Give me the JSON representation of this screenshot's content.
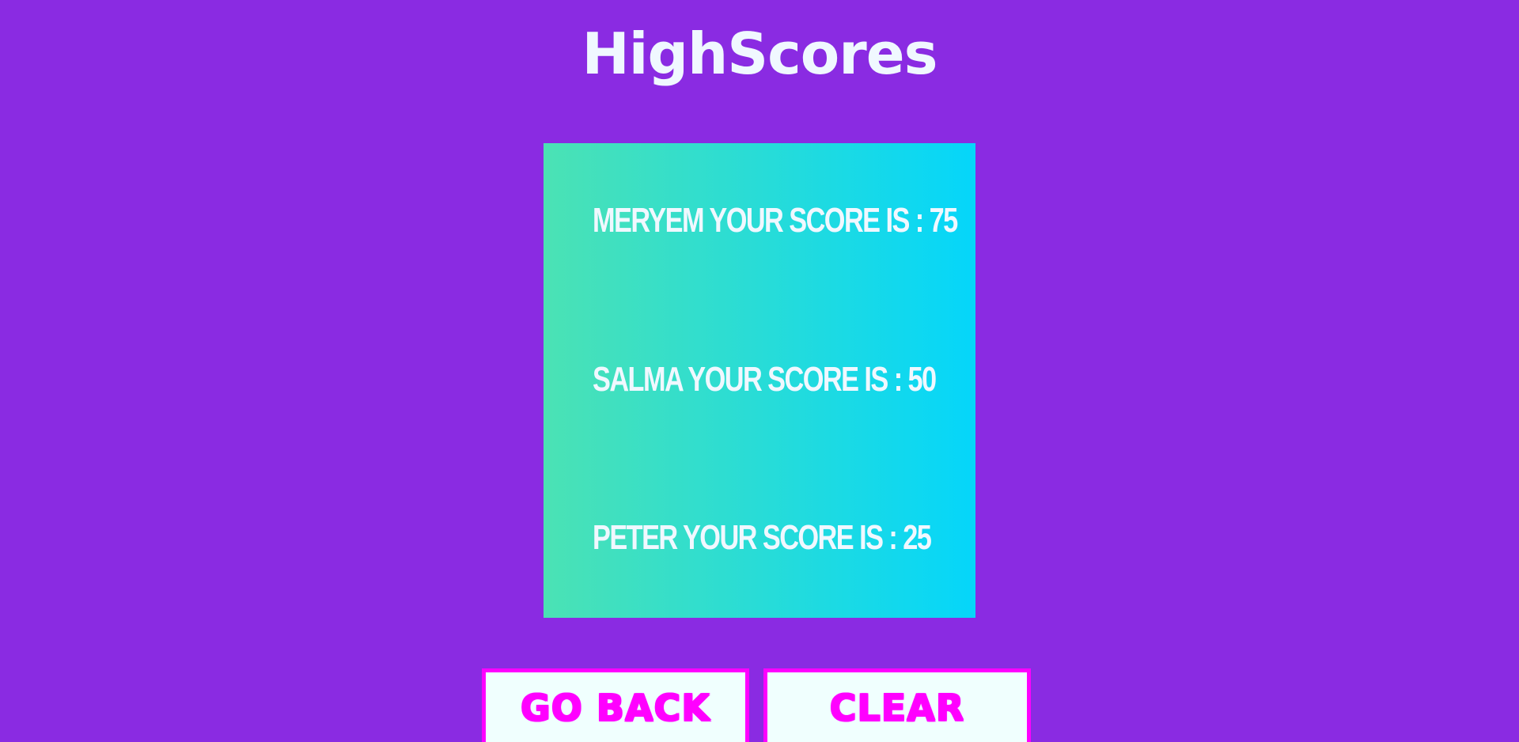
{
  "page": {
    "title": "HighScores"
  },
  "scores": [
    {
      "text": "MERYEM YOUR SCORE IS : 75"
    },
    {
      "text": "SALMA YOUR SCORE IS : 50"
    },
    {
      "text": "PETER YOUR SCORE IS : 25"
    }
  ],
  "buttons": {
    "go_back_label": "GO BACK",
    "clear_label": "CLEAR"
  },
  "colors": {
    "background": "#8a2be2",
    "card_gradient_start": "#4be2b4",
    "card_gradient_end": "#05d6fa",
    "text": "#f0f8ff",
    "button_accent": "#ff00ff",
    "button_background": "#f0fffe"
  }
}
